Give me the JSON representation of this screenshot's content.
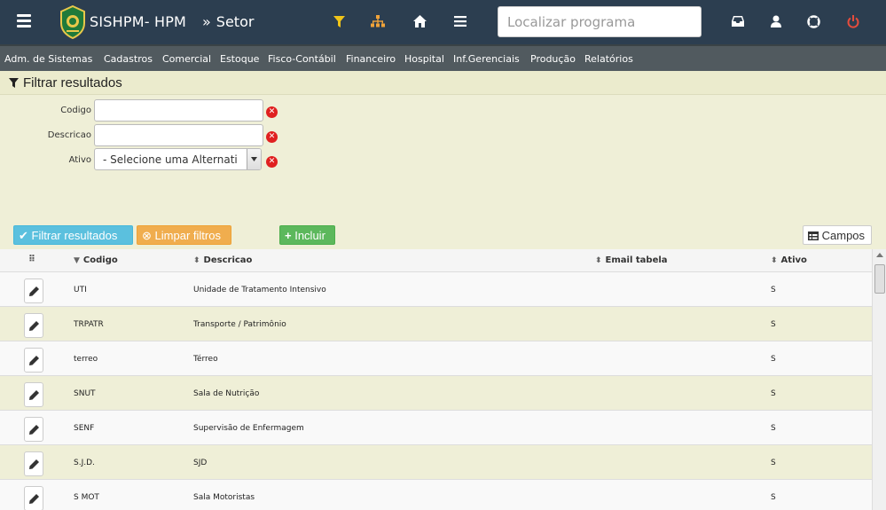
{
  "header": {
    "app_title": "SISHPM- HPM",
    "breadcrumb_sep": "»",
    "breadcrumb": "Setor",
    "search_placeholder": "Localizar programa"
  },
  "icons": {
    "filter": "filter-icon",
    "sitemap": "sitemap-icon",
    "home": "home-icon",
    "menu": "list-icon",
    "inbox": "inbox-icon",
    "user": "user-icon",
    "help": "life-ring-icon",
    "power": "power-icon"
  },
  "colors": {
    "topbar": "#2c3e50",
    "filter_icon": "#f0c419",
    "sitemap_icon": "#f0a33a",
    "power_icon": "#e74c3c",
    "row_alt": "#efefd7"
  },
  "menu": [
    "Adm. de Sistemas",
    "Cadastros",
    "Comercial",
    "Estoque",
    "Fisco-Contábil",
    "Financeiro",
    "Hospital",
    "Inf.Gerenciais",
    "Produção",
    "Relatórios"
  ],
  "filter": {
    "title": "Filtrar resultados",
    "fields": [
      {
        "label": "Codigo",
        "value": ""
      },
      {
        "label": "Descricao",
        "value": ""
      },
      {
        "label": "Ativo",
        "value": "- Selecione uma Alternati"
      }
    ]
  },
  "buttons": {
    "filter": "Filtrar resultados",
    "clear": "Limpar filtros",
    "add": "Incluir",
    "fields": "Campos"
  },
  "table": {
    "columns": [
      "Codigo",
      "Descricao",
      "Email tabela",
      "Ativo"
    ],
    "rows": [
      {
        "codigo": "UTI",
        "descricao": "Unidade de Tratamento Intensivo",
        "email": "",
        "ativo": "S"
      },
      {
        "codigo": "TRPATR",
        "descricao": "Transporte / Patrimônio",
        "email": "",
        "ativo": "S"
      },
      {
        "codigo": "terreo",
        "descricao": "Térreo",
        "email": "",
        "ativo": "S"
      },
      {
        "codigo": "SNUT",
        "descricao": "Sala de Nutrição",
        "email": "",
        "ativo": "S"
      },
      {
        "codigo": "SENF",
        "descricao": "Supervisão de Enfermagem",
        "email": "",
        "ativo": "S"
      },
      {
        "codigo": "S.J.D.",
        "descricao": "SJD",
        "email": "",
        "ativo": "S"
      },
      {
        "codigo": "S MOT",
        "descricao": "Sala Motoristas",
        "email": "",
        "ativo": "S"
      }
    ]
  }
}
